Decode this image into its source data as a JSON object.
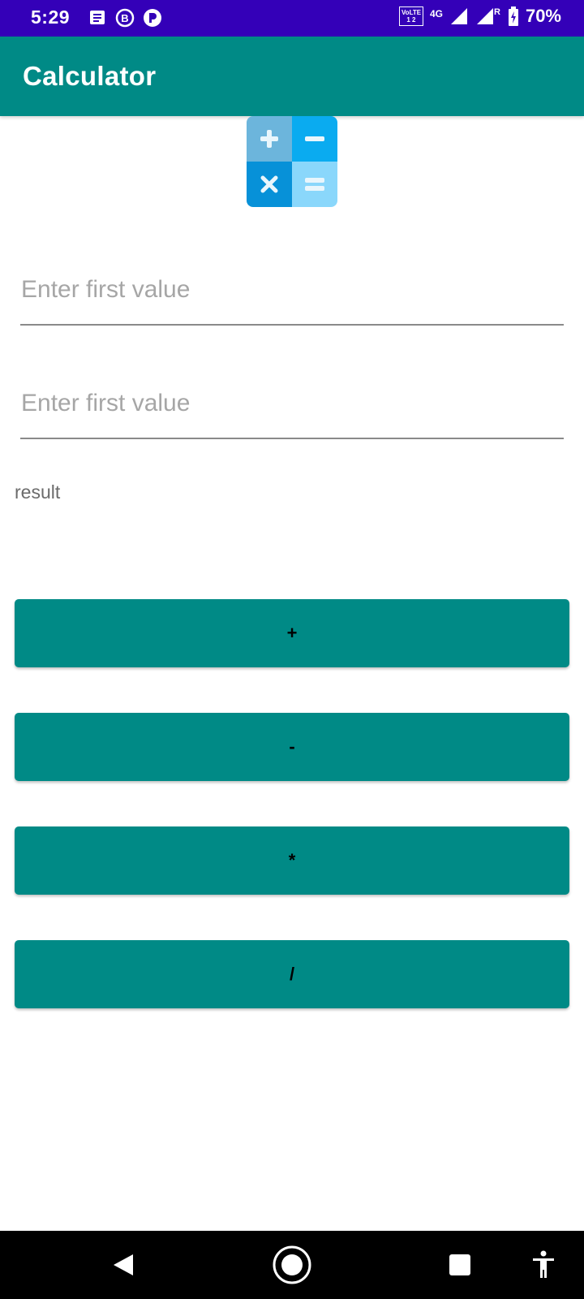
{
  "status_bar": {
    "time": "5:29",
    "left_icons": [
      "message-icon",
      "b-circle-icon",
      "p-circle-icon"
    ],
    "volte_top": "VoLTE",
    "volte_bottom": "1 2",
    "network": "4G",
    "roaming": "R",
    "battery": "70%",
    "background": "#3400b8"
  },
  "app_bar": {
    "title": "Calculator",
    "background": "#008a86"
  },
  "logo": {
    "icon": "calculator-logo-icon",
    "colors": [
      "#6cb5dc",
      "#0aabf0",
      "#0791d8",
      "#8ad7fb"
    ]
  },
  "inputs": {
    "first": {
      "placeholder": "Enter first value",
      "value": ""
    },
    "second": {
      "placeholder": "Enter first value",
      "value": ""
    }
  },
  "result_label": "result",
  "buttons": {
    "add": "+",
    "subtract": "-",
    "multiply": "*",
    "divide": "/",
    "color": "#008a86"
  },
  "nav_bar": {
    "icons": [
      "back-icon",
      "home-icon",
      "recents-icon",
      "accessibility-icon"
    ]
  }
}
